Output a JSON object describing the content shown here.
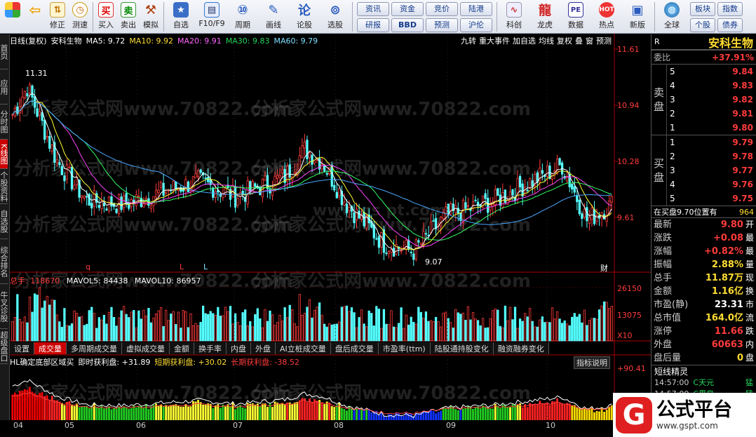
{
  "toolbar": {
    "buttons1": [
      {
        "label": "",
        "icon": "grid-icon"
      },
      {
        "label": "",
        "icon": "back-icon"
      },
      {
        "label": "修正",
        "icon": "wrench-icon"
      },
      {
        "label": "测速",
        "icon": "speed-icon"
      }
    ],
    "buttons2": [
      {
        "label": "买入",
        "icon": "buy-icon"
      },
      {
        "label": "卖出",
        "icon": "sell-icon"
      },
      {
        "label": "模拟",
        "icon": "hammer-icon"
      }
    ],
    "buttons3": [
      {
        "label": "自选",
        "icon": "folder-star-icon"
      },
      {
        "label": "F10/F9",
        "icon": "f10-icon"
      },
      {
        "label": "周期",
        "icon": "period-icon"
      },
      {
        "label": "画线",
        "icon": "pen-icon"
      },
      {
        "label": "论股",
        "icon": "discuss-icon"
      },
      {
        "label": "选股",
        "icon": "stock-pick-icon"
      }
    ],
    "pills": [
      "资讯",
      "资金",
      "竞价",
      "陆港",
      "研报",
      "BBD",
      "预测",
      "沪伦"
    ],
    "buttons4": [
      {
        "label": "科创",
        "icon": "chart-icon"
      },
      {
        "label": "龙虎",
        "icon": "dragon-icon"
      },
      {
        "label": "数据",
        "icon": "pe-icon"
      },
      {
        "label": "热点",
        "icon": "hot-icon"
      },
      {
        "label": "新版",
        "icon": "new-icon"
      }
    ],
    "global": {
      "label": "全球",
      "icon": "globe-icon"
    },
    "right_pills": [
      "板块",
      "指数",
      "个股",
      "债券"
    ]
  },
  "vtabs": [
    {
      "label": "首页",
      "active": false
    },
    {
      "label": "应用",
      "active": false
    },
    {
      "label": "分时图",
      "active": false
    },
    {
      "label": "K线图",
      "active": true
    },
    {
      "label": "个股资料",
      "active": false
    },
    {
      "label": "自选股",
      "active": false
    },
    {
      "label": "综合排名",
      "active": false
    },
    {
      "label": "牛叉诊股",
      "active": false
    },
    {
      "label": "超级盘口",
      "active": false
    }
  ],
  "chart_header": {
    "period": "日线(复权)",
    "name": "安科生物",
    "ma5": "MA5: 9.72",
    "ma10": "MA10: 9.92",
    "ma20": "MA20: 9.91",
    "ma30": "MA30: 9.83",
    "ma60": "MA60: 9.79",
    "tabs": [
      "九转",
      "重大事件",
      "加自选",
      "均线",
      "复权",
      "叠",
      "窗",
      "预测"
    ]
  },
  "price_axis": [
    "11.61",
    "10.94",
    "10.28",
    "9.61"
  ],
  "price_annotations": {
    "high": "11.31",
    "low": "9.07"
  },
  "event_markers": [
    "q",
    "L",
    "L",
    "财"
  ],
  "volume_header": {
    "total": "总手: 118670",
    "mavol5": "MAVOL5: 84438",
    "mavol10": "MAVOL10: 86957"
  },
  "volume_axis": [
    "26150",
    "13075",
    "X10"
  ],
  "sub_tabs": [
    {
      "label": "设置",
      "active": false
    },
    {
      "label": "成交量",
      "active": true
    },
    {
      "label": "多周期成交量",
      "active": false
    },
    {
      "label": "虚拟成交量",
      "active": false
    },
    {
      "label": "金额",
      "active": false
    },
    {
      "label": "换手率",
      "active": false
    },
    {
      "label": "内盘",
      "active": false
    },
    {
      "label": "外盘",
      "active": false
    },
    {
      "label": "AI立桩成交量",
      "active": false
    },
    {
      "label": "盘后成交量",
      "active": false
    },
    {
      "label": "市盈率(ttm)",
      "active": false
    },
    {
      "label": "陆股通持股变化",
      "active": false
    },
    {
      "label": "融资融券变化",
      "active": false
    }
  ],
  "indicator_header": {
    "name": "HL确定底部区域买",
    "immediate": "即时获利盘: +31.89",
    "short": "短期获利盘: +30.02",
    "long": "长期获利盘: -38.52",
    "button": "指标说明"
  },
  "indicator_axis": [
    "+90.41"
  ],
  "months": [
    "04",
    "05",
    "06",
    "07",
    "08",
    "09",
    "10"
  ],
  "watermark": "分析家公式网www.70822.com",
  "center_watermark": "www.gs  pt.com",
  "quote": {
    "code": "R",
    "name": "安科生物",
    "weibi_label": "委比",
    "weibi": "+37.91%",
    "sell_label": [
      "卖",
      "盘"
    ],
    "buy_label": [
      "买",
      "盘"
    ],
    "sell": [
      {
        "n": "5",
        "price": "9.84"
      },
      {
        "n": "4",
        "price": "9.83"
      },
      {
        "n": "3",
        "price": "9.82"
      },
      {
        "n": "2",
        "price": "9.81"
      },
      {
        "n": "1",
        "price": "9.80"
      }
    ],
    "buy": [
      {
        "n": "1",
        "price": "9.79"
      },
      {
        "n": "2",
        "price": "9.78"
      },
      {
        "n": "3",
        "price": "9.77"
      },
      {
        "n": "4",
        "price": "9.76"
      },
      {
        "n": "5",
        "price": "9.75"
      }
    ],
    "position_label": "在买盘9.70位置有",
    "position_value": "964",
    "stats": [
      {
        "k": "最新",
        "v": "9.80",
        "extra": "开",
        "color": "red"
      },
      {
        "k": "涨跌",
        "v": "+0.08",
        "extra": "最",
        "color": "red"
      },
      {
        "k": "涨幅",
        "v": "+0.82%",
        "extra": "最",
        "color": "red"
      },
      {
        "k": "振幅",
        "v": "2.88%",
        "extra": "量",
        "color": "yellow"
      },
      {
        "k": "总手",
        "v": "11.87万",
        "extra": "现",
        "color": "yellow"
      },
      {
        "k": "金额",
        "v": "1.16亿",
        "extra": "换",
        "color": "yellow"
      },
      {
        "k": "市盈(静)",
        "v": "23.31",
        "extra": "市",
        "color": "white"
      },
      {
        "k": "总市值",
        "v": "164.0亿",
        "extra": "流",
        "color": "yellow"
      },
      {
        "k": "涨停",
        "v": "11.66",
        "extra": "跌",
        "color": "red"
      },
      {
        "k": "外盘",
        "v": "60663",
        "extra": "内",
        "color": "red"
      },
      {
        "k": "盘后量",
        "v": "0",
        "extra": "盘",
        "color": "yellow"
      }
    ],
    "dx_title": "短线精灵",
    "dx_rows": [
      {
        "t": "14:57:00",
        "nm": "C天元",
        "tag": "猛"
      },
      {
        "t": "14:57:00",
        "nm": "C果泉",
        "tag": "猛"
      }
    ]
  },
  "logo": {
    "text": "公式平台",
    "url": "www.gspt.com"
  }
}
